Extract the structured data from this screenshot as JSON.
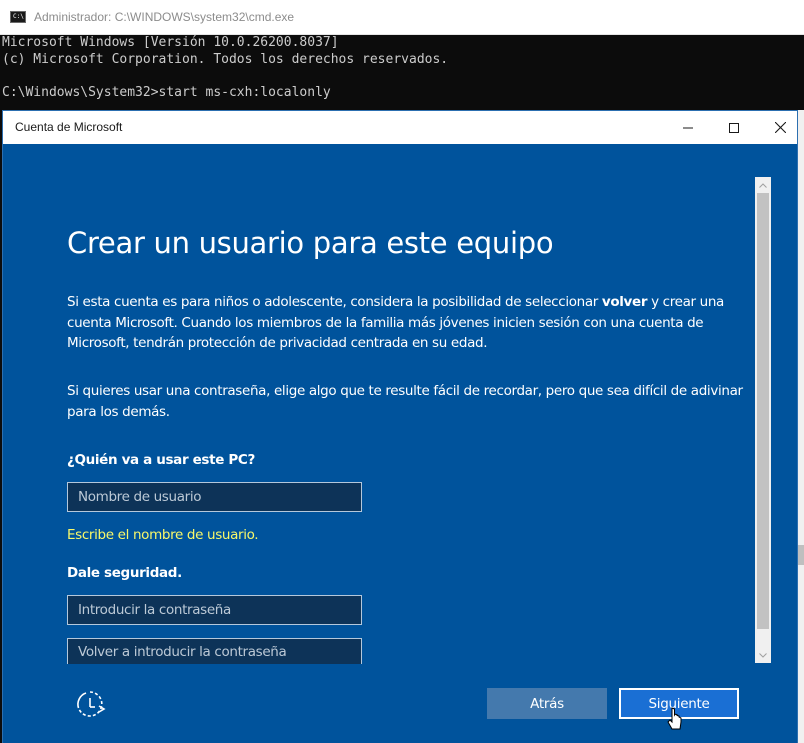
{
  "cmd": {
    "title": "Administrador: C:\\WINDOWS\\system32\\cmd.exe",
    "icon_label": "C:\\",
    "lines": [
      "Microsoft Windows [Versión 10.0.26200.8037]",
      "(c) Microsoft Corporation. Todos los derechos reservados.",
      "",
      "C:\\Windows\\System32>start ms-cxh:localonly"
    ]
  },
  "dialog": {
    "title": "Cuenta de Microsoft",
    "heading": "Crear un usuario para este equipo",
    "para1_before": "Si esta cuenta es para niños o adolescente, considera la posibilidad de seleccionar ",
    "para1_bold": "volver",
    "para1_after": " y crear una cuenta Microsoft. Cuando los miembros de la familia más jóvenes inicien sesión con una cuenta de Microsoft, tendrán protección de privacidad centrada en su edad.",
    "para2": "Si quieres usar una contraseña, elige algo que te resulte fácil de recordar, pero que sea difícil de adivinar para los demás.",
    "who_label": "¿Quién va a usar este PC?",
    "username_placeholder": "Nombre de usuario",
    "username_hint": "Escribe el nombre de usuario.",
    "security_label": "Dale seguridad.",
    "password_placeholder": "Introducir la contraseña",
    "password_confirm_placeholder": "Volver a introducir la contraseña",
    "back_button": "Atrás",
    "next_button": "Siguiente",
    "icons": {
      "minimize": "minimize-icon",
      "maximize": "maximize-icon",
      "close": "close-icon",
      "accessibility": "ease-of-access-icon"
    }
  },
  "colors": {
    "dialog_bg": "#00539c",
    "hint": "#f8f86a",
    "next_button": "#1a6fd4",
    "back_button": "#4479ad"
  }
}
